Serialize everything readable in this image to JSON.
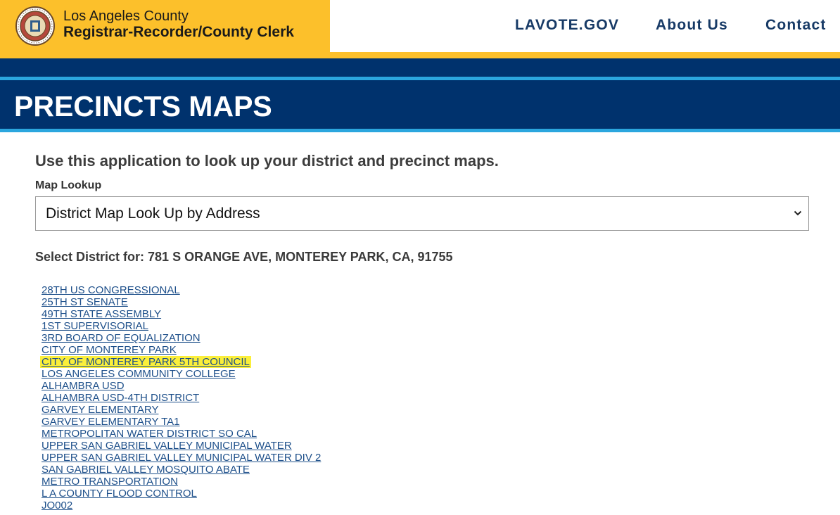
{
  "header": {
    "org_line1": "Los Angeles County",
    "org_line2": "Registrar-Recorder/County Clerk",
    "nav": [
      "LAVOTE.GOV",
      "About Us",
      "Contact"
    ]
  },
  "page": {
    "title": "PRECINCTS MAPS"
  },
  "main": {
    "intro": "Use this application to look up your district and precinct maps.",
    "lookup_label": "Map Lookup",
    "lookup_selected": "District Map Look Up by Address",
    "select_district_text": "Select District for: 781 S ORANGE AVE, MONTEREY PARK, CA, 91755",
    "districts": [
      "28TH US CONGRESSIONAL",
      "25TH ST SENATE",
      "49TH STATE ASSEMBLY",
      "1ST SUPERVISORIAL",
      "3RD BOARD OF EQUALIZATION",
      "CITY OF MONTEREY PARK",
      "CITY OF MONTEREY PARK 5TH COUNCIL",
      "LOS ANGELES COMMUNITY COLLEGE",
      "ALHAMBRA USD",
      "ALHAMBRA USD-4TH DISTRICT",
      "GARVEY ELEMENTARY",
      "GARVEY ELEMENTARY TA1",
      "METROPOLITAN WATER DISTRICT SO CAL",
      "UPPER SAN GABRIEL VALLEY MUNICIPAL WATER",
      "UPPER SAN GABRIEL VALLEY MUNICIPAL WATER DIV 2",
      "SAN GABRIEL VALLEY MOSQUITO ABATE",
      "METRO TRANSPORTATION",
      "L A COUNTY FLOOD CONTROL",
      "JO002"
    ],
    "highlighted_district_index": 6
  },
  "colors": {
    "gold": "#fcc02b",
    "navy": "#00326d",
    "light_blue": "#2ba6de",
    "nav_text": "#173a66",
    "link": "#1d4f8a",
    "highlight": "#fbef3a"
  },
  "icons": {
    "seal": "county-seal-icon",
    "dropdown": "chevron-down-icon"
  }
}
